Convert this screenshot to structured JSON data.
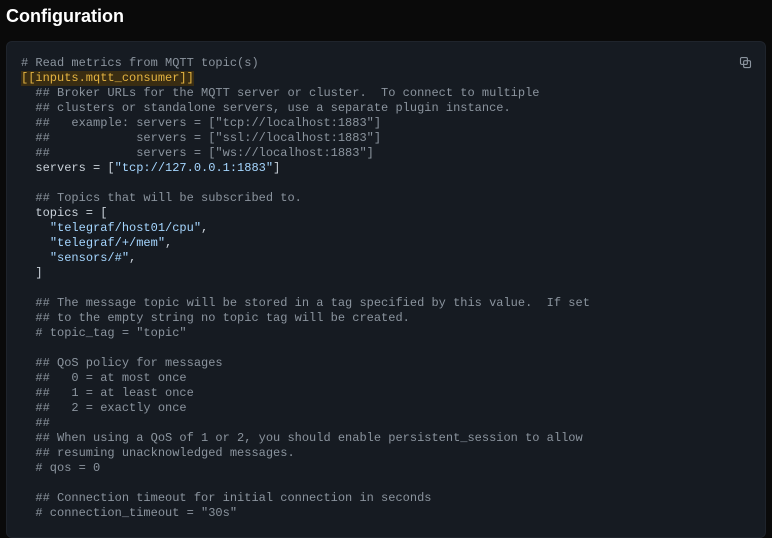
{
  "title": "Configuration",
  "copy_icon": "copy",
  "code": {
    "lines": [
      [
        [
          "c",
          "# Read metrics from MQTT topic(s)"
        ]
      ],
      [
        [
          "hl",
          "[[inputs.mqtt_consumer]]"
        ]
      ],
      [
        [
          "c",
          "  ## Broker URLs for the MQTT server or cluster.  To connect to multiple"
        ]
      ],
      [
        [
          "c",
          "  ## clusters or standalone servers, use a separate plugin instance."
        ]
      ],
      [
        [
          "c",
          "  ##   example: servers = [\"tcp://localhost:1883\"]"
        ]
      ],
      [
        [
          "c",
          "  ##            servers = [\"ssl://localhost:1883\"]"
        ]
      ],
      [
        [
          "c",
          "  ##            servers = [\"ws://localhost:1883\"]"
        ]
      ],
      [
        [
          "k",
          "  servers = ["
        ],
        [
          "s",
          "\"tcp://127.0.0.1:1883\""
        ],
        [
          "p",
          "]"
        ]
      ],
      [
        [
          "p",
          ""
        ]
      ],
      [
        [
          "c",
          "  ## Topics that will be subscribed to."
        ]
      ],
      [
        [
          "k",
          "  topics = ["
        ]
      ],
      [
        [
          "p",
          "    "
        ],
        [
          "s",
          "\"telegraf/host01/cpu\""
        ],
        [
          "p",
          ","
        ]
      ],
      [
        [
          "p",
          "    "
        ],
        [
          "s",
          "\"telegraf/+/mem\""
        ],
        [
          "p",
          ","
        ]
      ],
      [
        [
          "p",
          "    "
        ],
        [
          "s",
          "\"sensors/#\""
        ],
        [
          "p",
          ","
        ]
      ],
      [
        [
          "p",
          "  ]"
        ]
      ],
      [
        [
          "p",
          ""
        ]
      ],
      [
        [
          "c",
          "  ## The message topic will be stored in a tag specified by this value.  If set"
        ]
      ],
      [
        [
          "c",
          "  ## to the empty string no topic tag will be created."
        ]
      ],
      [
        [
          "c",
          "  # topic_tag = \"topic\""
        ]
      ],
      [
        [
          "p",
          ""
        ]
      ],
      [
        [
          "c",
          "  ## QoS policy for messages"
        ]
      ],
      [
        [
          "c",
          "  ##   0 = at most once"
        ]
      ],
      [
        [
          "c",
          "  ##   1 = at least once"
        ]
      ],
      [
        [
          "c",
          "  ##   2 = exactly once"
        ]
      ],
      [
        [
          "c",
          "  ##"
        ]
      ],
      [
        [
          "c",
          "  ## When using a QoS of 1 or 2, you should enable persistent_session to allow"
        ]
      ],
      [
        [
          "c",
          "  ## resuming unacknowledged messages."
        ]
      ],
      [
        [
          "c",
          "  # qos = 0"
        ]
      ],
      [
        [
          "p",
          ""
        ]
      ],
      [
        [
          "c",
          "  ## Connection timeout for initial connection in seconds"
        ]
      ],
      [
        [
          "c",
          "  # connection_timeout = \"30s\""
        ]
      ]
    ]
  }
}
